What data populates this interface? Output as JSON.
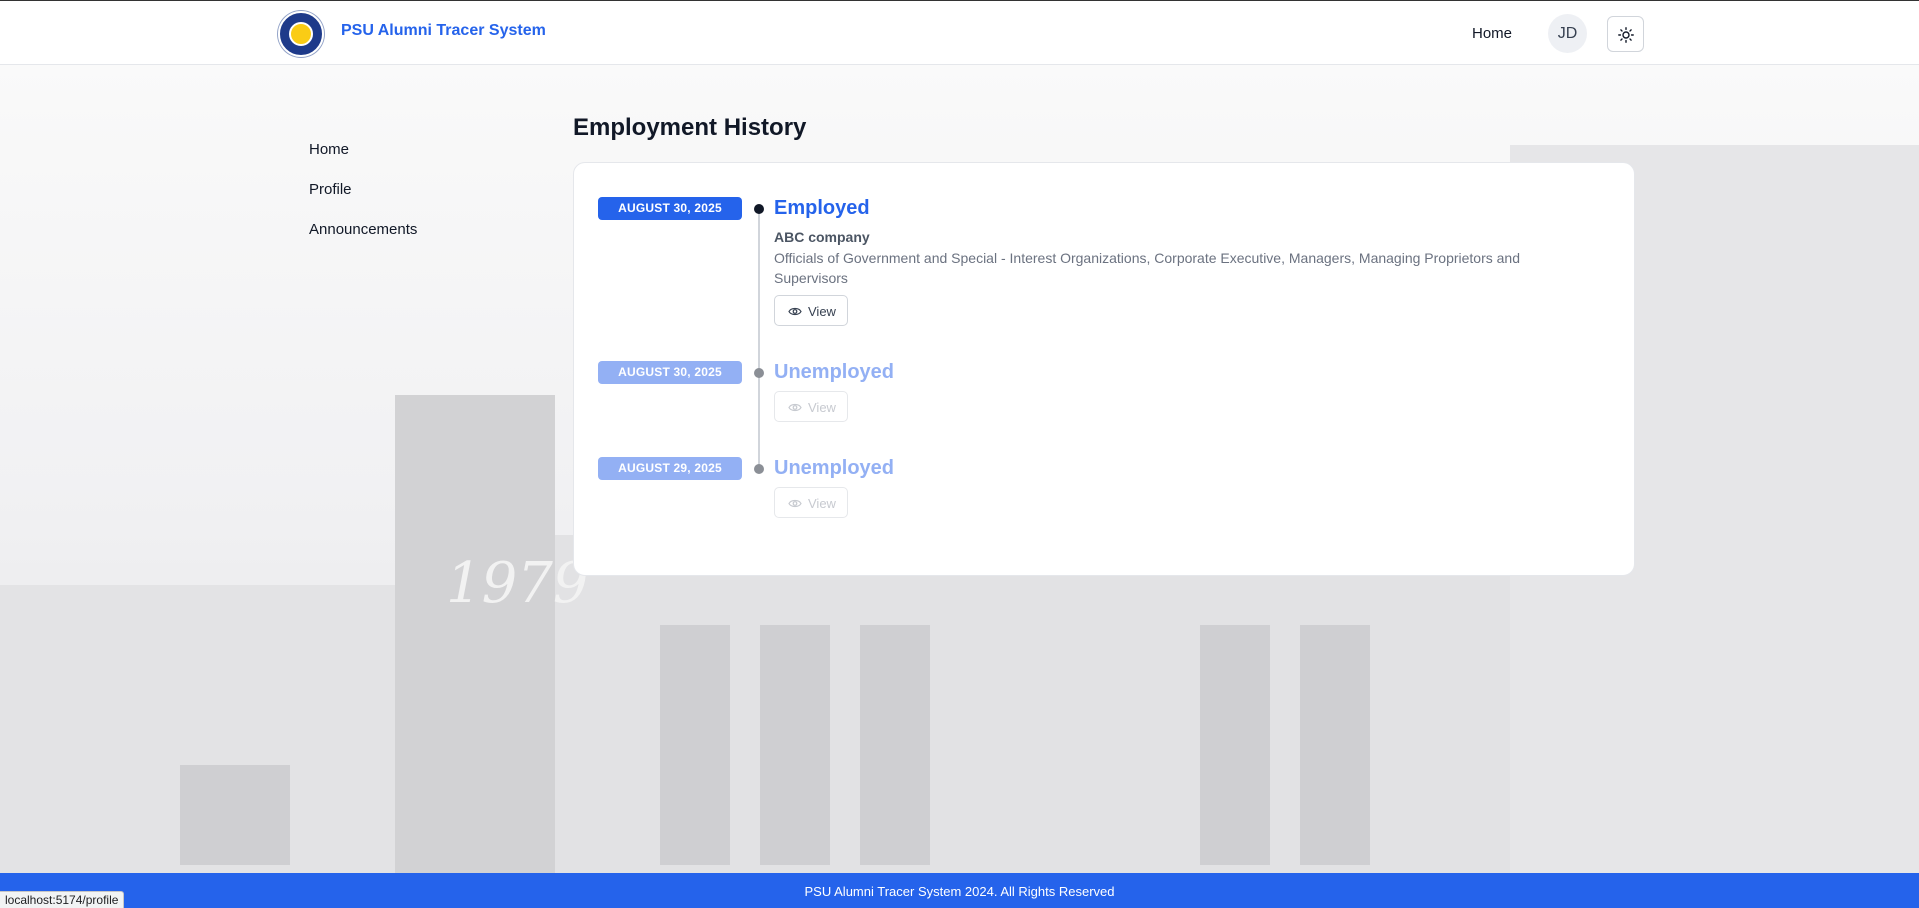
{
  "header": {
    "brand": "PSU Alumni Tracer System",
    "nav_home": "Home",
    "avatar_initials": "JD"
  },
  "sidebar": {
    "items": [
      {
        "label": "Home"
      },
      {
        "label": "Profile"
      },
      {
        "label": "Announcements"
      }
    ]
  },
  "main": {
    "title": "Employment History",
    "entries": [
      {
        "date": "AUGUST 30, 2025",
        "status": "Employed",
        "company": "ABC company",
        "occupation": "Officials of Government and Special - Interest Organizations, Corporate Executive, Managers, Managing Proprietors and Supervisors",
        "view_label": "View"
      },
      {
        "date": "AUGUST 30, 2025",
        "status": "Unemployed",
        "view_label": "View"
      },
      {
        "date": "AUGUST 29, 2025",
        "status": "Unemployed",
        "view_label": "View"
      }
    ]
  },
  "background": {
    "numerals": "1979"
  },
  "footer": {
    "text": "PSU Alumni Tracer System 2024. All Rights Reserved"
  },
  "browser_status": {
    "url": "localhost:5174/profile"
  },
  "colors": {
    "accent": "#2563eb",
    "accent_faded": "#93b0f4",
    "footer_bg": "#2563eb"
  },
  "icons": {
    "theme_toggle": "sun-icon",
    "view": "eye-icon",
    "logo": "university-seal-logo"
  }
}
